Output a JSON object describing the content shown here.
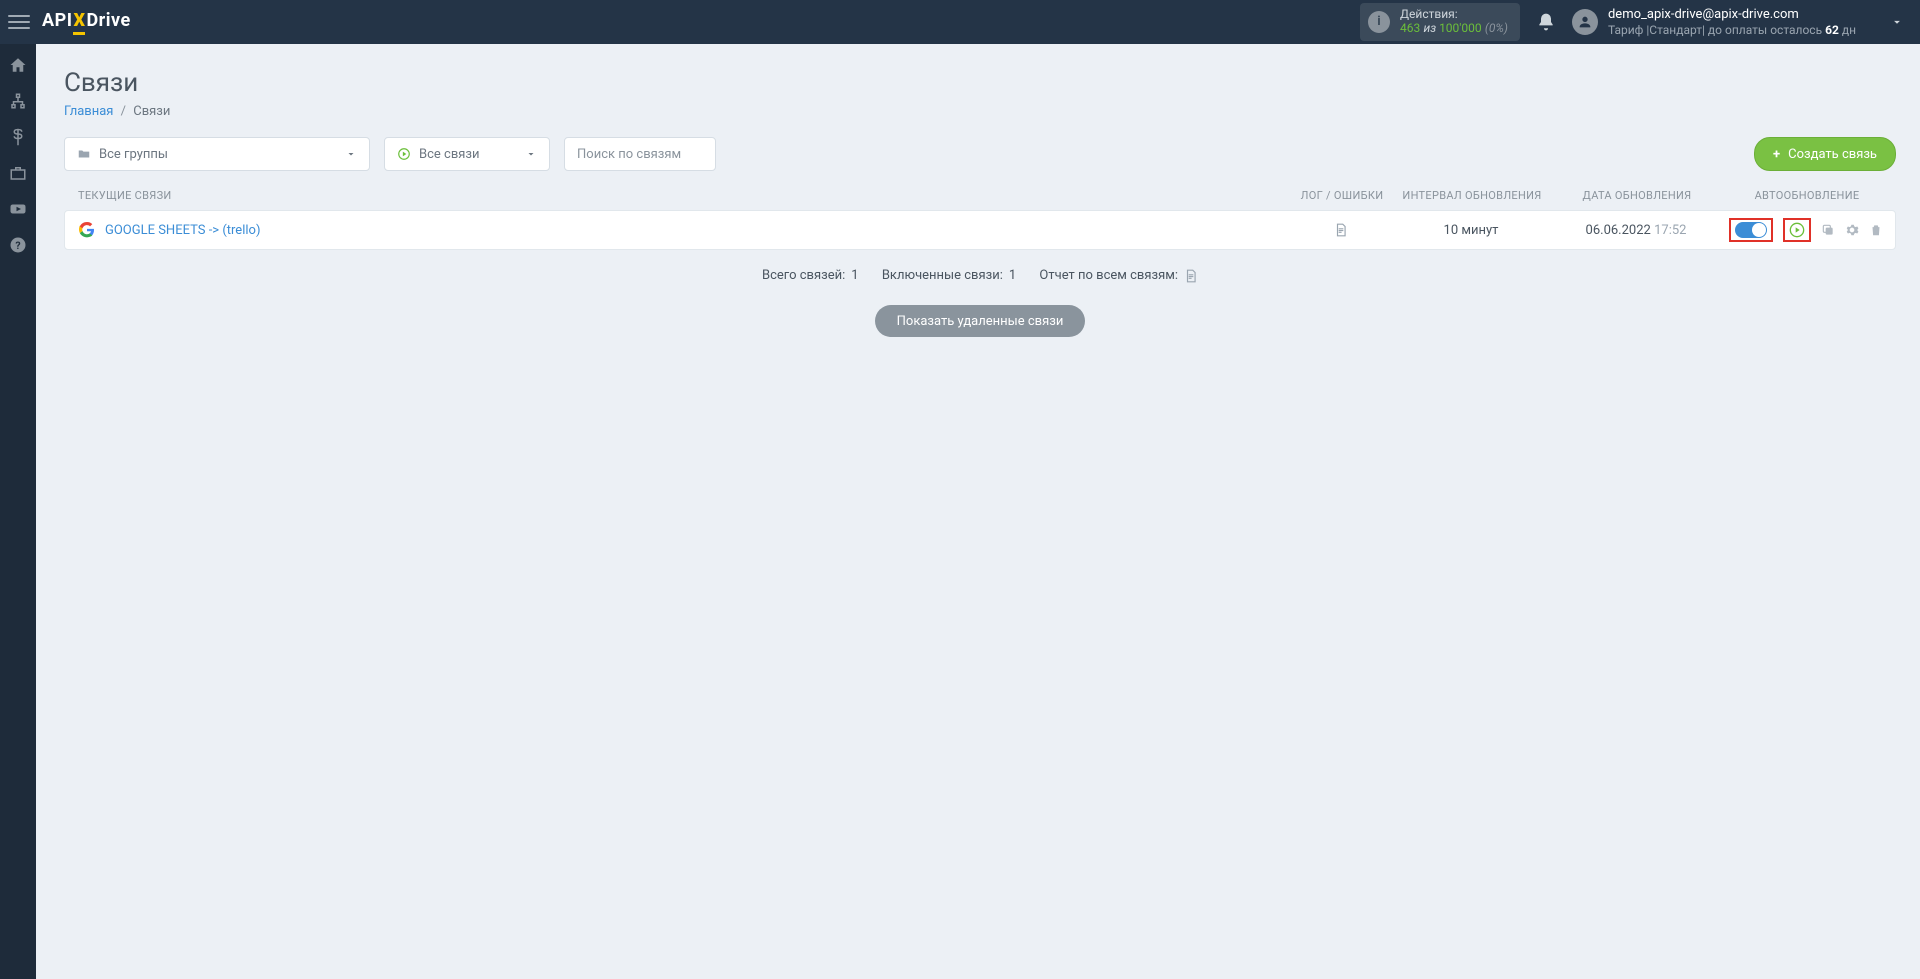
{
  "header": {
    "logo_parts": {
      "api": "API",
      "x": "X",
      "drive": "Drive"
    },
    "actions_box": {
      "title": "Действия:",
      "used": "463",
      "of_word": "из",
      "limit": "100'000",
      "percent": "(0%)"
    },
    "user": {
      "email": "demo_apix-drive@apix-drive.com",
      "tariff_line_prefix": "Тариф |Стандарт| до оплаты осталось ",
      "days": "62",
      "days_suffix": " дн"
    }
  },
  "sidebar_icons": [
    "home",
    "sitemap",
    "dollar",
    "briefcase",
    "youtube",
    "help"
  ],
  "page": {
    "title": "Связи",
    "breadcrumb": {
      "home": "Главная",
      "current": "Связи"
    }
  },
  "filters": {
    "groups_label": "Все группы",
    "conns_label": "Все связи",
    "search_placeholder": "Поиск по связям",
    "create_label": "Создать связь"
  },
  "table": {
    "headers": {
      "name": "ТЕКУЩИЕ СВЯЗИ",
      "log": "ЛОГ / ОШИБКИ",
      "interval": "ИНТЕРВАЛ ОБНОВЛЕНИЯ",
      "date": "ДАТА ОБНОВЛЕНИЯ",
      "auto": "АВТООБНОВЛЕНИЕ"
    },
    "rows": [
      {
        "name": "GOOGLE SHEETS -> (trello)",
        "interval": "10 минут",
        "date": "06.06.2022",
        "time": "17:52",
        "auto_on": true
      }
    ]
  },
  "summary": {
    "total_label": "Всего связей:",
    "total_count": "1",
    "enabled_label": "Включенные связи:",
    "enabled_count": "1",
    "report_label": "Отчет по всем связям:"
  },
  "deleted_button": "Показать удаленные связи"
}
